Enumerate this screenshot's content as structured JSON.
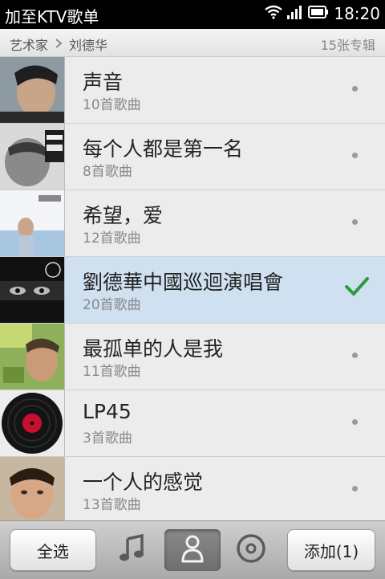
{
  "statusbar": {
    "title": "加至KTV歌单",
    "time": "18:20"
  },
  "breadcrumb": {
    "root": "艺术家",
    "current": "刘德华",
    "count": "15张专辑"
  },
  "albums": [
    {
      "name": "声音",
      "songs": "10首歌曲",
      "selected": false
    },
    {
      "name": "每个人都是第一名",
      "songs": "8首歌曲",
      "selected": false
    },
    {
      "name": "希望，爱",
      "songs": "12首歌曲",
      "selected": false
    },
    {
      "name": "劉德華中國巡迴演唱會",
      "songs": "20首歌曲",
      "selected": true
    },
    {
      "name": "最孤单的人是我",
      "songs": "11首歌曲",
      "selected": false
    },
    {
      "name": "LP45",
      "songs": "3首歌曲",
      "selected": false
    },
    {
      "name": "一个人的感觉",
      "songs": "13首歌曲",
      "selected": false
    }
  ],
  "toolbar": {
    "select_all": "全选",
    "add": "添加(1)"
  },
  "colors": {
    "selected_row": "#cfe1f1",
    "check": "#2e9a3e"
  }
}
